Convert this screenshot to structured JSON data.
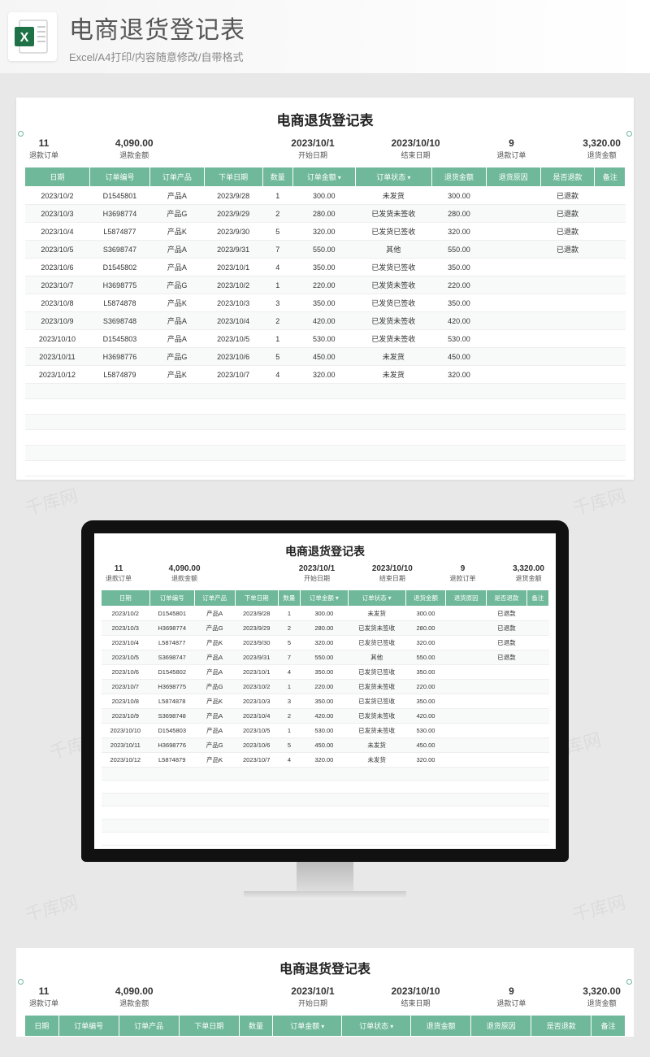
{
  "header": {
    "title": "电商退货登记表",
    "subtitle": "Excel/A4打印/内容随意修改/自带格式"
  },
  "watermark": "千库网",
  "sheet": {
    "title": "电商退货登记表",
    "summary": [
      {
        "value": "11",
        "label": "退款订单"
      },
      {
        "value": "4,090.00",
        "label": "退款金额"
      },
      {
        "value": "2023/10/1",
        "label": "开始日期"
      },
      {
        "value": "2023/10/10",
        "label": "结束日期"
      },
      {
        "value": "9",
        "label": "退款订单"
      },
      {
        "value": "3,320.00",
        "label": "退货金额"
      }
    ],
    "columns": [
      {
        "label": "日期",
        "filter": false
      },
      {
        "label": "订单编号",
        "filter": false
      },
      {
        "label": "订单产品",
        "filter": false
      },
      {
        "label": "下单日期",
        "filter": false
      },
      {
        "label": "数量",
        "filter": false
      },
      {
        "label": "订单金额",
        "filter": true
      },
      {
        "label": "订单状态",
        "filter": true
      },
      {
        "label": "退货金额",
        "filter": false
      },
      {
        "label": "退货原因",
        "filter": false
      },
      {
        "label": "是否退款",
        "filter": false
      },
      {
        "label": "备注",
        "filter": false
      }
    ],
    "rows": [
      [
        "2023/10/2",
        "D1545801",
        "产品A",
        "2023/9/28",
        "1",
        "300.00",
        "未发货",
        "300.00",
        "",
        "已退款",
        ""
      ],
      [
        "2023/10/3",
        "H3698774",
        "产品G",
        "2023/9/29",
        "2",
        "280.00",
        "已发货未签收",
        "280.00",
        "",
        "已退款",
        ""
      ],
      [
        "2023/10/4",
        "L5874877",
        "产品K",
        "2023/9/30",
        "5",
        "320.00",
        "已发货已签收",
        "320.00",
        "",
        "已退款",
        ""
      ],
      [
        "2023/10/5",
        "S3698747",
        "产品A",
        "2023/9/31",
        "7",
        "550.00",
        "其他",
        "550.00",
        "",
        "已退款",
        ""
      ],
      [
        "2023/10/6",
        "D1545802",
        "产品A",
        "2023/10/1",
        "4",
        "350.00",
        "已发货已签收",
        "350.00",
        "",
        "",
        ""
      ],
      [
        "2023/10/7",
        "H3698775",
        "产品G",
        "2023/10/2",
        "1",
        "220.00",
        "已发货未签收",
        "220.00",
        "",
        "",
        ""
      ],
      [
        "2023/10/8",
        "L5874878",
        "产品K",
        "2023/10/3",
        "3",
        "350.00",
        "已发货已签收",
        "350.00",
        "",
        "",
        ""
      ],
      [
        "2023/10/9",
        "S3698748",
        "产品A",
        "2023/10/4",
        "2",
        "420.00",
        "已发货未签收",
        "420.00",
        "",
        "",
        ""
      ],
      [
        "2023/10/10",
        "D1545803",
        "产品A",
        "2023/10/5",
        "1",
        "530.00",
        "已发货未签收",
        "530.00",
        "",
        "",
        ""
      ],
      [
        "2023/10/11",
        "H3698776",
        "产品G",
        "2023/10/6",
        "5",
        "450.00",
        "未发货",
        "450.00",
        "",
        "",
        ""
      ],
      [
        "2023/10/12",
        "L5874879",
        "产品K",
        "2023/10/7",
        "4",
        "320.00",
        "未发货",
        "320.00",
        "",
        "",
        ""
      ]
    ],
    "empty_rows": 6
  }
}
